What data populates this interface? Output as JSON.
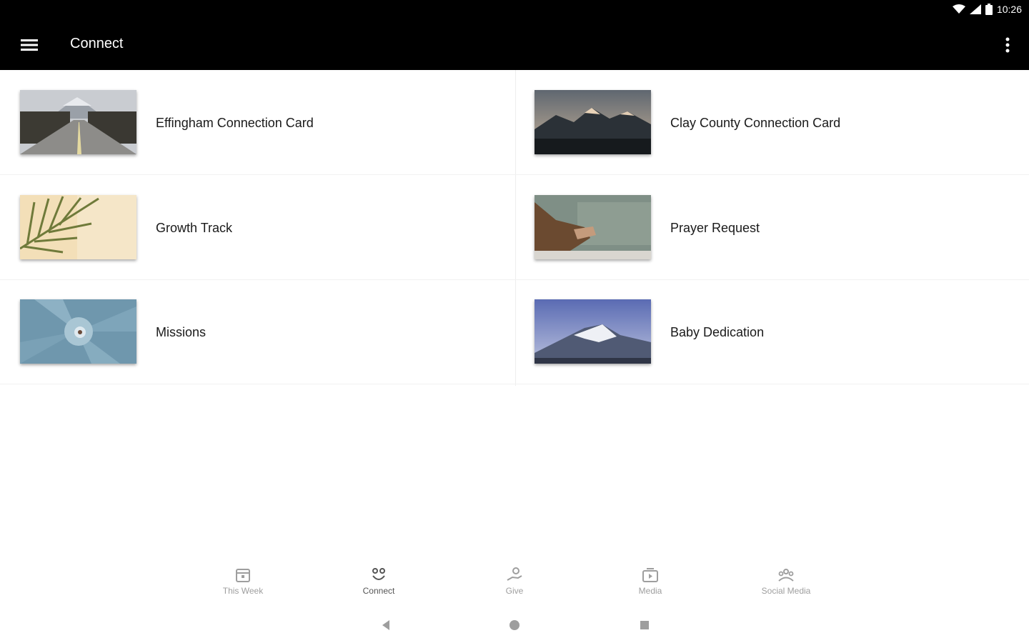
{
  "status": {
    "time": "10:26"
  },
  "app": {
    "title": "Connect"
  },
  "tiles": [
    {
      "label": "Effingham Connection Card",
      "image": "road-mountains"
    },
    {
      "label": "Clay County Connection Card",
      "image": "mountain-sunset"
    },
    {
      "label": "Growth Track",
      "image": "palm-leaf"
    },
    {
      "label": "Prayer Request",
      "image": "praying-hands"
    },
    {
      "label": "Missions",
      "image": "succulent"
    },
    {
      "label": "Baby Dedication",
      "image": "snowy-mountains"
    }
  ],
  "tabs": [
    {
      "label": "This Week",
      "icon": "calendar-icon",
      "active": false
    },
    {
      "label": "Connect",
      "icon": "connect-icon",
      "active": true
    },
    {
      "label": "Give",
      "icon": "give-icon",
      "active": false
    },
    {
      "label": "Media",
      "icon": "media-icon",
      "active": false
    },
    {
      "label": "Social Media",
      "icon": "people-icon",
      "active": false
    }
  ],
  "colors": {
    "appbar": "#000000",
    "background": "#ffffff",
    "tab_inactive": "#9e9e9e"
  }
}
